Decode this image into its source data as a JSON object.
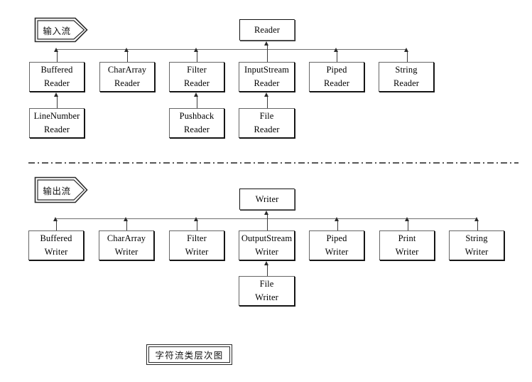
{
  "diagram": {
    "caption": "字符流类层次图",
    "colors": {
      "background": "#ffffff",
      "box_border": "#666666",
      "box_shadow": "#1a1a1a",
      "connector": "#6e6e6e",
      "arrow": "#2b2b2b",
      "text": "#000000"
    },
    "sections": [
      {
        "banner_label": "输入流",
        "banner_name": "input-stream-banner",
        "root": {
          "line1": "Reader",
          "line2": ""
        },
        "children": [
          {
            "line1": "Buffered",
            "line2": "Reader"
          },
          {
            "line1": "CharArray",
            "line2": "Reader"
          },
          {
            "line1": "Filter",
            "line2": "Reader"
          },
          {
            "line1": "InputStream",
            "line2": "Reader"
          },
          {
            "line1": "Piped",
            "line2": "Reader"
          },
          {
            "line1": "String",
            "line2": "Reader"
          }
        ],
        "grandchildren": [
          {
            "parent_index": 0,
            "line1": "LineNumber",
            "line2": "Reader"
          },
          {
            "parent_index": 2,
            "line1": "Pushback",
            "line2": "Reader"
          },
          {
            "parent_index": 3,
            "line1": "File",
            "line2": "Reader"
          }
        ]
      },
      {
        "banner_label": "输出流",
        "banner_name": "output-stream-banner",
        "root": {
          "line1": "Writer",
          "line2": ""
        },
        "children": [
          {
            "line1": "Buffered",
            "line2": "Writer"
          },
          {
            "line1": "CharArray",
            "line2": "Writer"
          },
          {
            "line1": "Filter",
            "line2": "Writer"
          },
          {
            "line1": "OutputStream",
            "line2": "Writer"
          },
          {
            "line1": "Piped",
            "line2": "Writer"
          },
          {
            "line1": "Print",
            "line2": "Writer"
          },
          {
            "line1": "String",
            "line2": "Writer"
          }
        ],
        "grandchildren": [
          {
            "parent_index": 3,
            "line1": "File",
            "line2": "Writer"
          }
        ]
      }
    ]
  }
}
